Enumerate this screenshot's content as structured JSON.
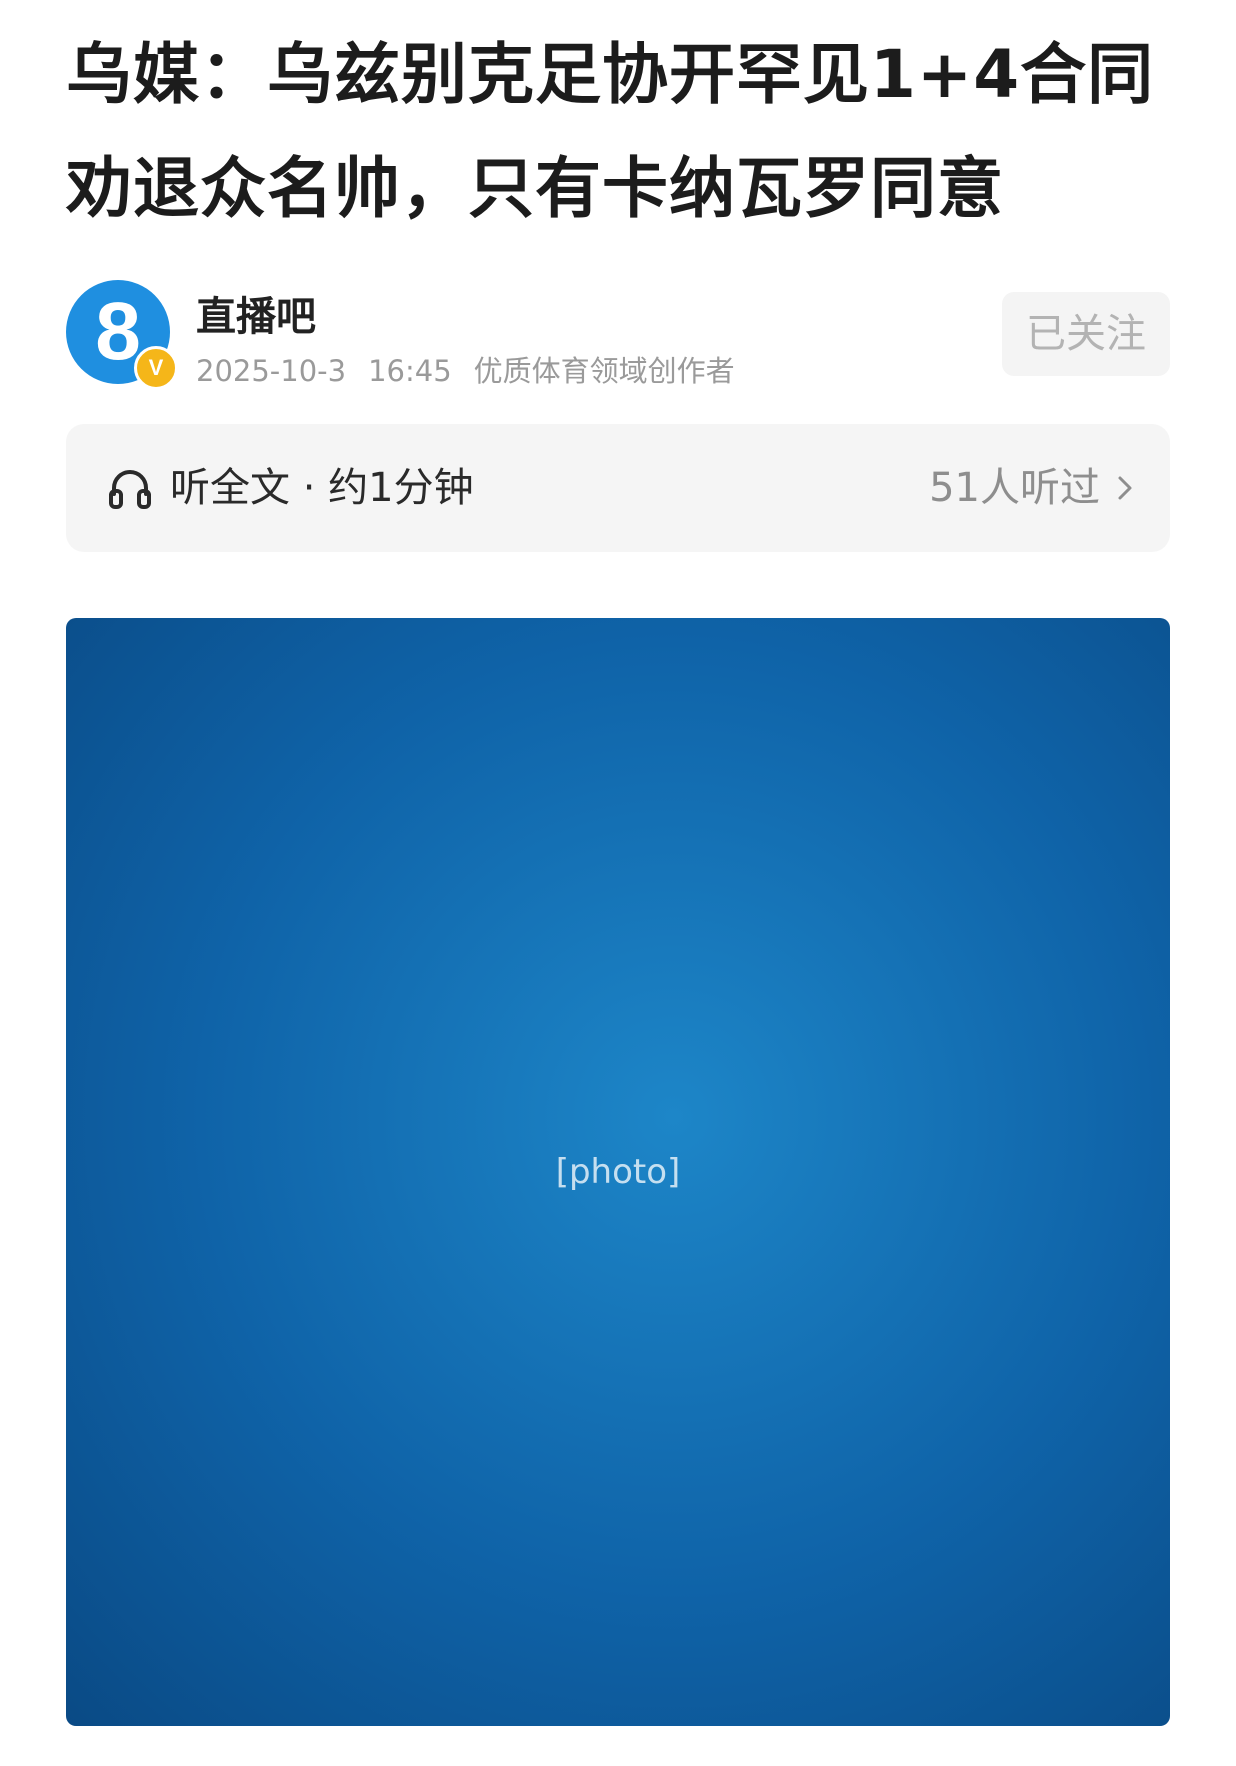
{
  "article": {
    "title": "乌媒：乌兹别克足协开罕见1+4合同劝退众名帅，只有卡纳瓦罗同意"
  },
  "author": {
    "avatar_text": "8",
    "verified_badge": "V",
    "name": "直播吧",
    "date": "2025-10-3",
    "time": "16:45",
    "credential": "优质体育领域创作者",
    "follow_label": "已关注"
  },
  "listen": {
    "icon": "headphone-icon",
    "label": "听全文 · 约1分钟",
    "count": "51人听过",
    "chevron": "chevron-right-icon"
  },
  "colors": {
    "avatar_bg": "#1f8fe0",
    "badge": "#f5b619",
    "meta_text": "#9a9a9a",
    "bar_bg": "#f5f5f5"
  }
}
